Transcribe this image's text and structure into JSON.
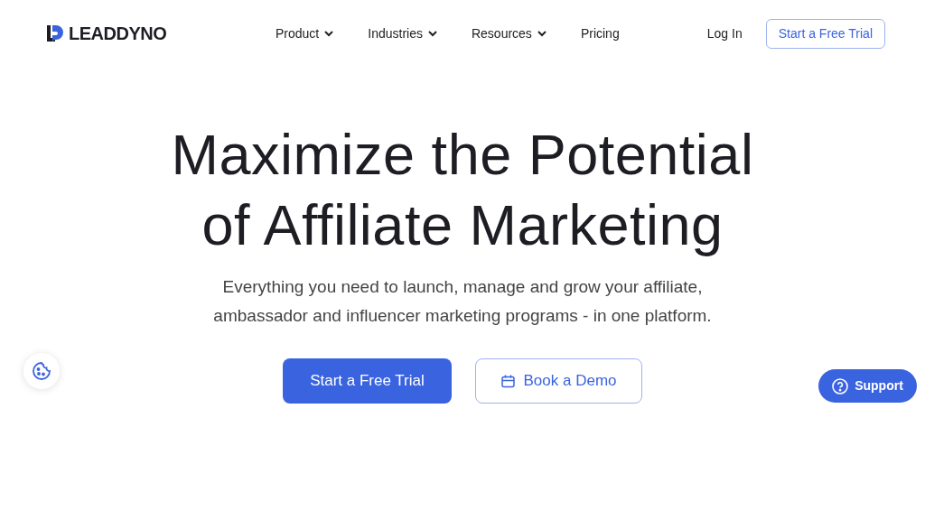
{
  "logo": {
    "text": "LEADDYNO"
  },
  "nav": [
    {
      "label": "Product",
      "has_menu": true
    },
    {
      "label": "Industries",
      "has_menu": true
    },
    {
      "label": "Resources",
      "has_menu": true
    },
    {
      "label": "Pricing",
      "has_menu": false
    }
  ],
  "header_actions": {
    "login": "Log In",
    "trial": "Start a Free Trial"
  },
  "hero": {
    "title_lines": [
      "Maximize the Potential",
      "of Affiliate Marketing"
    ],
    "subtitle_lines": [
      "Everything you need to launch, manage and grow your affiliate,",
      "ambassador and influencer marketing programs - in one platform."
    ],
    "primary_button": "Start a Free Trial",
    "secondary_button": "Book a Demo"
  },
  "support_button": "Support"
}
